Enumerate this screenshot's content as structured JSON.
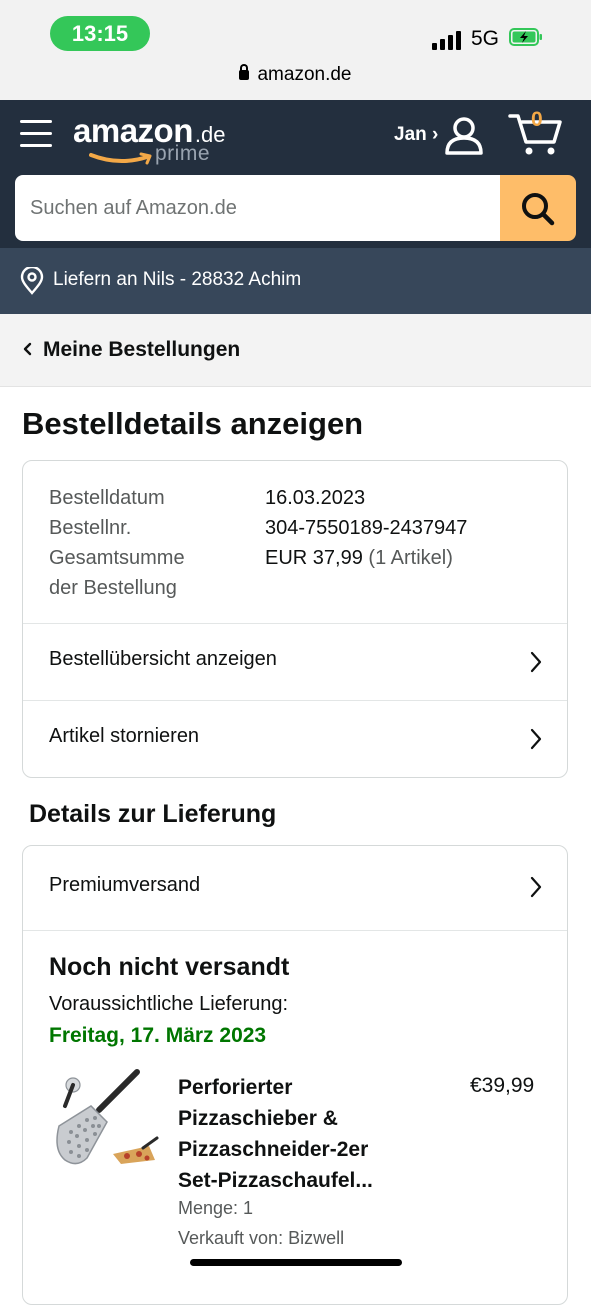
{
  "status_bar": {
    "time": "13:15",
    "network": "5G",
    "url": "amazon.de"
  },
  "header": {
    "logo_word": "amazon",
    "logo_tld": ".de",
    "logo_prime": "prime",
    "account_label": "Jan ›",
    "cart_count": "0",
    "search_placeholder": "Suchen auf Amazon.de"
  },
  "deliver_to": "Liefern an Nils - 28832 Achim",
  "back_link": "Meine Bestellungen",
  "page_title": "Bestelldetails anzeigen",
  "order_summary": {
    "date_label": "Bestelldatum",
    "date_value": "16.03.2023",
    "number_label": "Bestellnr.",
    "number_value": "304-7550189-2437947",
    "total_label_line1": "Gesamtsumme",
    "total_label_line2": "der Bestellung",
    "total_value": "EUR 37,99",
    "total_count": "(1 Artikel)"
  },
  "order_links": [
    {
      "label": "Bestellübersicht anzeigen"
    },
    {
      "label": "Artikel stornieren"
    }
  ],
  "delivery": {
    "section_title": "Details zur Lieferung",
    "shipping_method": "Premiumversand",
    "status": "Noch nicht versandt",
    "eta_label": "Voraussichtliche Lieferung:",
    "eta_date": "Freitag, 17. März 2023",
    "product": {
      "title": "Perforierter Pizzaschieber & Pizzaschneider-2er Set-Pizzaschaufel...",
      "price": "€39,99",
      "quantity": "Menge: 1",
      "seller": "Verkauft von: Bizwell"
    }
  },
  "colors": {
    "header_bg": "#232f3e",
    "deliver_bg": "#37475a",
    "search_button": "#febd69",
    "eta_green": "#007600",
    "cart_orange": "#f3a847"
  }
}
